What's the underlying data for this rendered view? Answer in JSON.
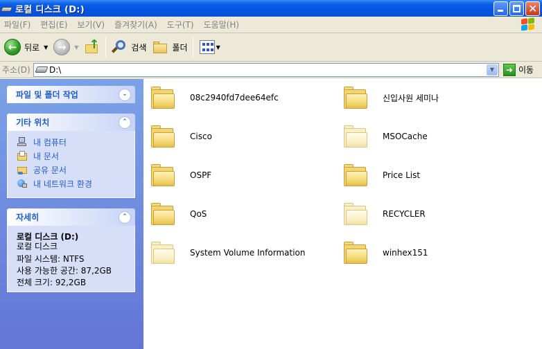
{
  "window": {
    "title": "로컬 디스크 (D:)"
  },
  "menu": [
    "파일(F)",
    "편집(E)",
    "보기(V)",
    "즐겨찾기(A)",
    "도구(T)",
    "도움말(H)"
  ],
  "toolbar": {
    "back_label": "뒤로",
    "search_label": "검색",
    "folders_label": "폴더"
  },
  "address": {
    "label": "주소(D)",
    "value": "D:\\",
    "go_label": "이동"
  },
  "panels": {
    "tasks": {
      "title": "파일 및 폴더 작업"
    },
    "places": {
      "title": "기타 위치",
      "items": [
        {
          "label": "내 컴퓨터",
          "icon": "my-computer-icon"
        },
        {
          "label": "내 문서",
          "icon": "my-documents-icon"
        },
        {
          "label": "공유 문서",
          "icon": "shared-documents-icon"
        },
        {
          "label": "내 네트워크 환경",
          "icon": "network-places-icon"
        }
      ]
    },
    "details": {
      "title": "자세히",
      "name": "로컬 디스크 (D:)",
      "type": "로컬 디스크",
      "filesystem": "파일 시스템: NTFS",
      "free": "사용 가능한 공간: 87,2GB",
      "total": "전체 크기: 92,2GB"
    }
  },
  "files": [
    {
      "name": "08c2940fd7dee64efc",
      "hidden": false
    },
    {
      "name": "신입사원 세미나",
      "hidden": false
    },
    {
      "name": "Cisco",
      "hidden": false
    },
    {
      "name": "MSOCache",
      "hidden": true
    },
    {
      "name": "OSPF",
      "hidden": false
    },
    {
      "name": "Price List",
      "hidden": false
    },
    {
      "name": "QoS",
      "hidden": false
    },
    {
      "name": "RECYCLER",
      "hidden": true
    },
    {
      "name": "System Volume Information",
      "hidden": true
    },
    {
      "name": "winhex151",
      "hidden": false
    }
  ],
  "colors": {
    "titlebar": "#0554e0",
    "pane_header_text": "#215dc6",
    "pane_body": "#d6dff7",
    "folder": "#f3d46e"
  }
}
